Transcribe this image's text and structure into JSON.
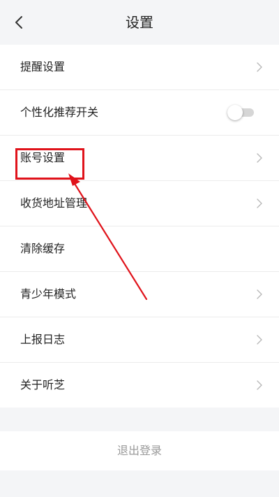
{
  "header": {
    "title": "设置",
    "back_icon": "chevron-left-icon"
  },
  "settings": [
    {
      "label": "提醒设置",
      "control": "chevron"
    },
    {
      "label": "个性化推荐开关",
      "control": "toggle",
      "toggle_on": false
    },
    {
      "label": "账号设置",
      "control": "chevron",
      "highlighted": true
    },
    {
      "label": "收货地址管理",
      "control": "chevron"
    },
    {
      "label": "清除缓存",
      "control": "none"
    },
    {
      "label": "青少年模式",
      "control": "chevron"
    },
    {
      "label": "上报日志",
      "control": "chevron"
    },
    {
      "label": "关于听芝",
      "control": "chevron"
    }
  ],
  "logout": {
    "label": "退出登录"
  },
  "colors": {
    "background": "#f4f5f7",
    "annotation": "#e0131b",
    "text": "#222222",
    "muted_text": "#999999"
  }
}
